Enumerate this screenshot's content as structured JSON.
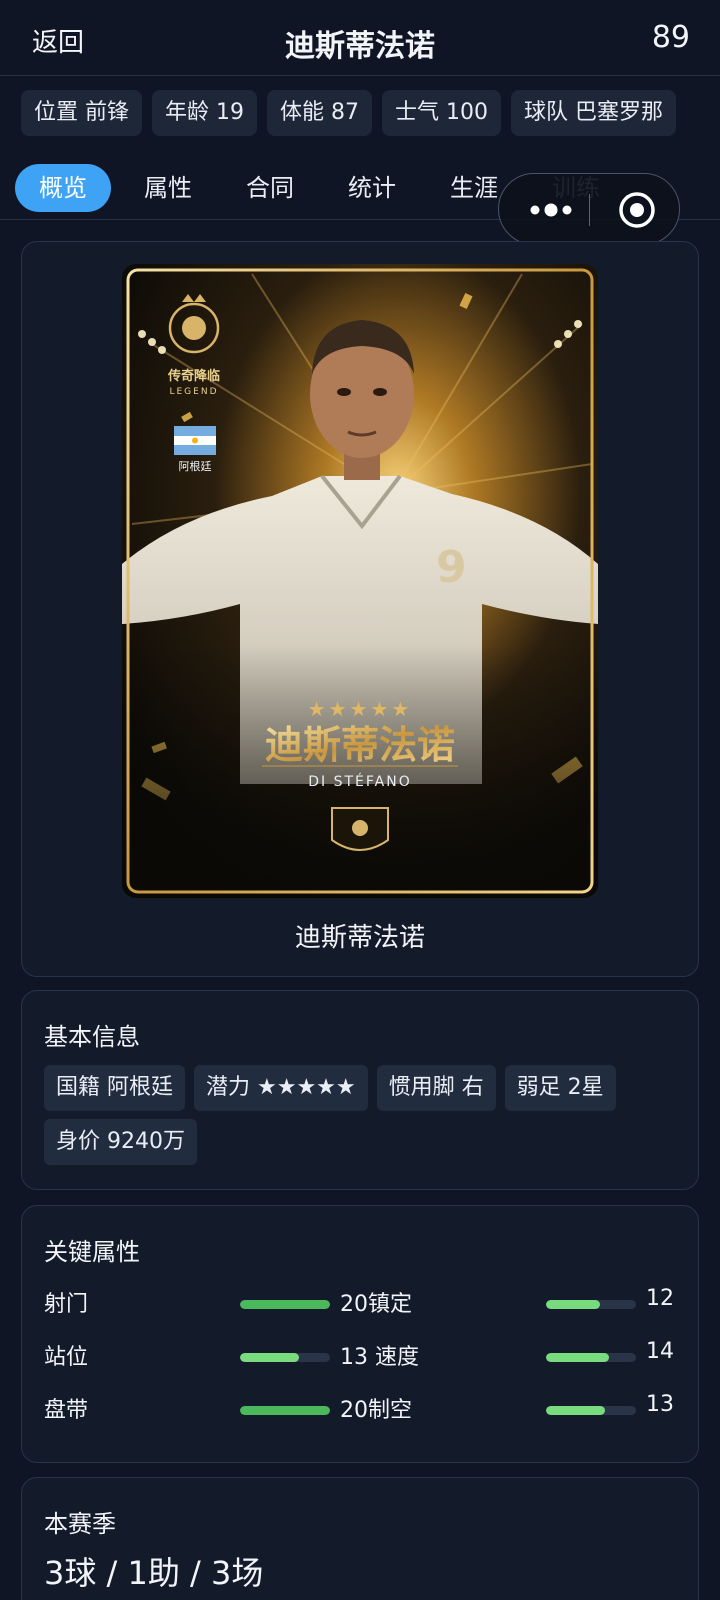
{
  "header": {
    "back_label": "返回",
    "title": "迪斯蒂法诺",
    "rating": "89"
  },
  "summary_chips": [
    "位置 前锋",
    "年龄 19",
    "体能 87",
    "士气 100",
    "球队 巴塞罗那"
  ],
  "tabs": [
    {
      "label": "概览",
      "active": true
    },
    {
      "label": "属性"
    },
    {
      "label": "合同"
    },
    {
      "label": "统计"
    },
    {
      "label": "生涯"
    },
    {
      "label": "训练"
    }
  ],
  "hero": {
    "caption": "迪斯蒂法诺",
    "art": {
      "badge_cn": "传奇降临",
      "badge_en": "LEGEND",
      "country": "阿根廷",
      "stars": "★★★★★",
      "name_cn": "迪斯蒂法诺",
      "name_en": "DI STÉFANO",
      "jersey_number": "9"
    }
  },
  "basic_info": {
    "title": "基本信息",
    "chips": [
      "国籍 阿根廷",
      "潜力 ★★★★★",
      "惯用脚 右",
      "弱足 2星",
      "身价 9240万"
    ]
  },
  "key_attributes": {
    "title": "关键属性",
    "rows": [
      {
        "left_label": "射门",
        "left_value": "20",
        "right_label": "镇定",
        "right_value": "12"
      },
      {
        "left_label": "站位",
        "left_value": "13",
        "right_label": "速度",
        "right_value": "14"
      },
      {
        "left_label": "盘带",
        "left_value": "20",
        "right_label": "制空",
        "right_value": "13"
      }
    ]
  },
  "season": {
    "title": "本赛季",
    "summary": "3球 / 1助 / 3场"
  },
  "colors": {
    "accent": "#3ea3f5",
    "bar_full": "#4cb85c",
    "bar_partial": "#78dc7e",
    "bar_track": "#2a3448",
    "card_gold": "#d7b46a"
  }
}
